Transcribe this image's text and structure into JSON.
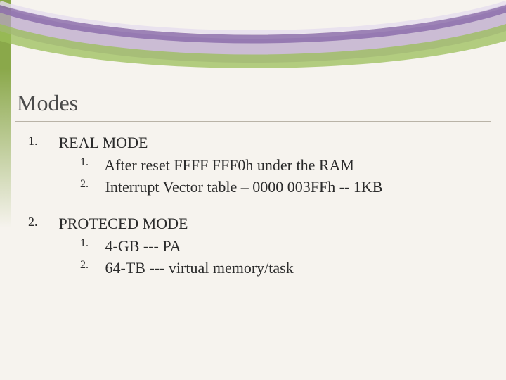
{
  "title": "Modes",
  "items": [
    {
      "num": "1.",
      "heading": "REAL MODE",
      "sub": [
        {
          "num": "1.",
          "text": "After reset FFFF FFF0h under the RAM"
        },
        {
          "num": "2.",
          "text": "Interrupt Vector table – 0000 003FFh  -- 1KB"
        }
      ]
    },
    {
      "num": "2.",
      "heading": "PROTECED MODE",
      "sub": [
        {
          "num": "1.",
          "text": "4-GB --- PA"
        },
        {
          "num": "2.",
          "text": "64-TB --- virtual memory/task"
        }
      ]
    }
  ]
}
